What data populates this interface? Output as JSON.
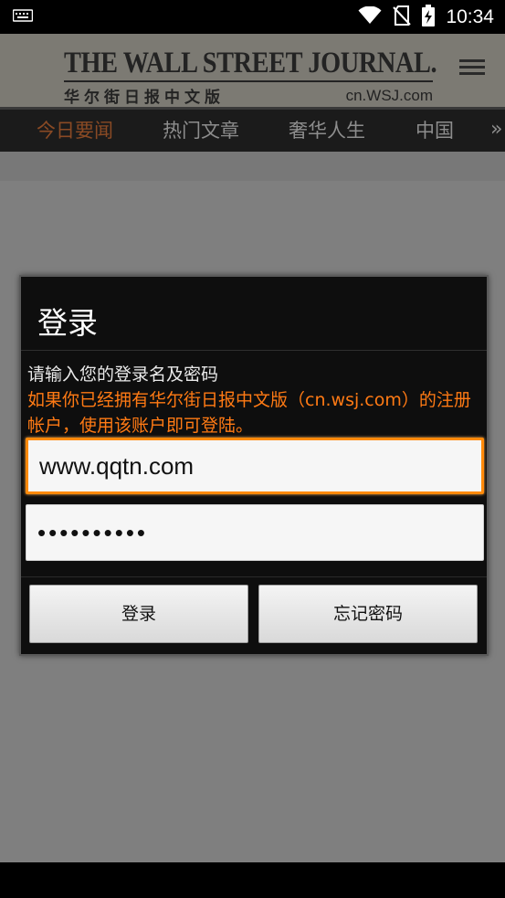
{
  "status_bar": {
    "time": "10:34",
    "icons": [
      "keyboard-icon",
      "wifi-icon",
      "no-sim-icon",
      "battery-charging-icon"
    ]
  },
  "header": {
    "masthead_title": "THE WALL STREET JOURNAL.",
    "masthead_chinese": "华尔街日报中文版",
    "masthead_domain": "cn.WSJ.com",
    "menu_icon": "hamburger-menu-icon"
  },
  "tabs": [
    {
      "label": "今日要闻",
      "active": true
    },
    {
      "label": "热门文章",
      "active": false
    },
    {
      "label": "奢华人生",
      "active": false
    },
    {
      "label": "中国",
      "active": false
    }
  ],
  "tabs_more": "»",
  "dialog": {
    "title": "登录",
    "message_line1": "请输入您的登录名及密码",
    "message_line2": "如果你已经拥有华尔街日报中文版（cn.wsj.com）的注册帐户，使用该账户即可登陆。",
    "username_value": "www.qqtn.com",
    "password_value": "••••••••••",
    "login_button": "登录",
    "forgot_button": "忘记密码"
  },
  "colors": {
    "accent_orange": "#ff7a14",
    "focus_border": "#ff8a0a",
    "active_tab": "#8a4a24"
  }
}
